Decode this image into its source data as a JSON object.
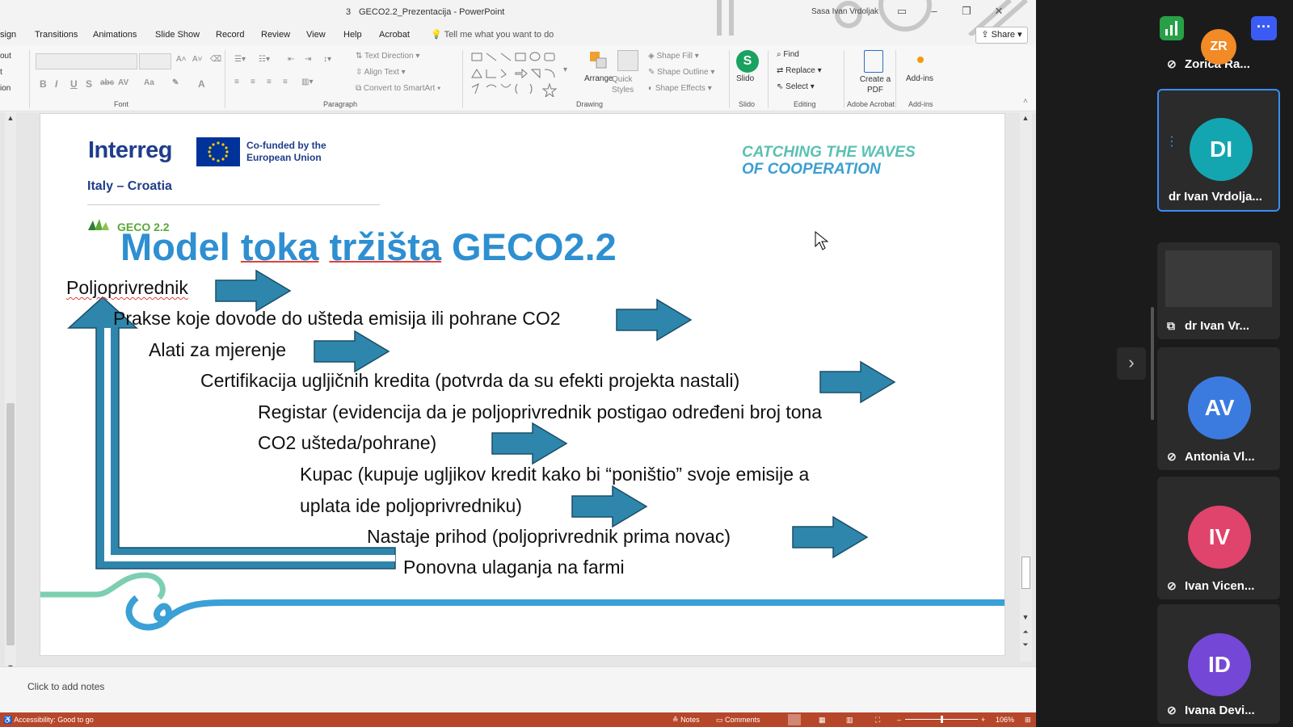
{
  "window": {
    "title": "GECO2.2_Prezentacija  -  PowerPoint",
    "title_prefix": "3",
    "user": "Sasa Ivan Vrdoljak"
  },
  "ribbon_tabs": [
    "sign",
    "Transitions",
    "Animations",
    "Slide Show",
    "Record",
    "Review",
    "View",
    "Help",
    "Acrobat"
  ],
  "tell_me": "Tell me what you want to do",
  "share_label": "Share",
  "left_cut_items": [
    "out",
    "t",
    "ion"
  ],
  "ribbon": {
    "groups": {
      "font": "Font",
      "paragraph": "Paragraph",
      "drawing": "Drawing",
      "slido": "Slido",
      "editing": "Editing",
      "adobe": "Adobe Acrobat",
      "addins": "Add-ins"
    },
    "text_direction": "Text Direction",
    "align_text": "Align Text",
    "convert_smartart": "Convert to SmartArt",
    "arrange": "Arrange",
    "quick_styles": "Quick Styles",
    "shape_fill": "Shape Fill",
    "shape_outline": "Shape Outline",
    "shape_effects": "Shape Effects",
    "slido": "Slido",
    "find": "Find",
    "replace": "Replace",
    "select": "Select",
    "create_pdf": "Create a PDF",
    "add_ins": "Add-ins"
  },
  "slide": {
    "logo": "Interreg",
    "eu_text": "Co-funded by the European Union",
    "region": "Italy – Croatia",
    "tagline_1": "CATCHING THE WAVES",
    "tagline_2": "OF COOPERATION",
    "geco_label": "GECO 2.2",
    "title_a": "Model ",
    "title_b": "toka",
    "title_c": " ",
    "title_d": "tržišta",
    "title_e": " GECO2.2",
    "lines": [
      "Poljoprivrednik",
      "Prakse koje dovode do ušteda emisija ili pohrane CO2",
      "Alati za mjerenje",
      "Certifikacija ugljičnih kredita (potvrda da su efekti projekta nastali)",
      "Registar (evidencija da je poljoprivrednik postigao određeni broj tona",
      "CO2 ušteda/pohrane)",
      "Kupac (kupuje ugljikov kredit kako bi “poništio” svoje emisije a",
      "uplata ide poljoprivredniku)",
      "Nastaje prihod (poljoprivrednik prima novac)",
      "Ponovna ulaganja na farmi"
    ]
  },
  "notes_placeholder": "Click to add notes",
  "status": {
    "accessibility": "Accessibility: Good to go",
    "notes": "Notes",
    "comments": "Comments",
    "zoom": "106%"
  },
  "participants": [
    {
      "initials": "ZR",
      "name": "Zorica Ra...",
      "color": "#f28a26"
    },
    {
      "initials": "DI",
      "name": "dr Ivan Vrdolja...",
      "color": "#14a6b0"
    },
    {
      "initials": "",
      "name": "dr Ivan Vr...",
      "color": "#2b2b2b"
    },
    {
      "initials": "AV",
      "name": "Antonia Vl...",
      "color": "#3b7be0"
    },
    {
      "initials": "IV",
      "name": "Ivan Vicen...",
      "color": "#e0436b"
    },
    {
      "initials": "ID",
      "name": "Ivana Devi...",
      "color": "#7547d6"
    }
  ],
  "colors": {
    "arrow": "#2e86ad",
    "title_blue": "#2e8fd1",
    "status_bar": "#b7472a",
    "active_tile_border": "#3a8df5"
  }
}
